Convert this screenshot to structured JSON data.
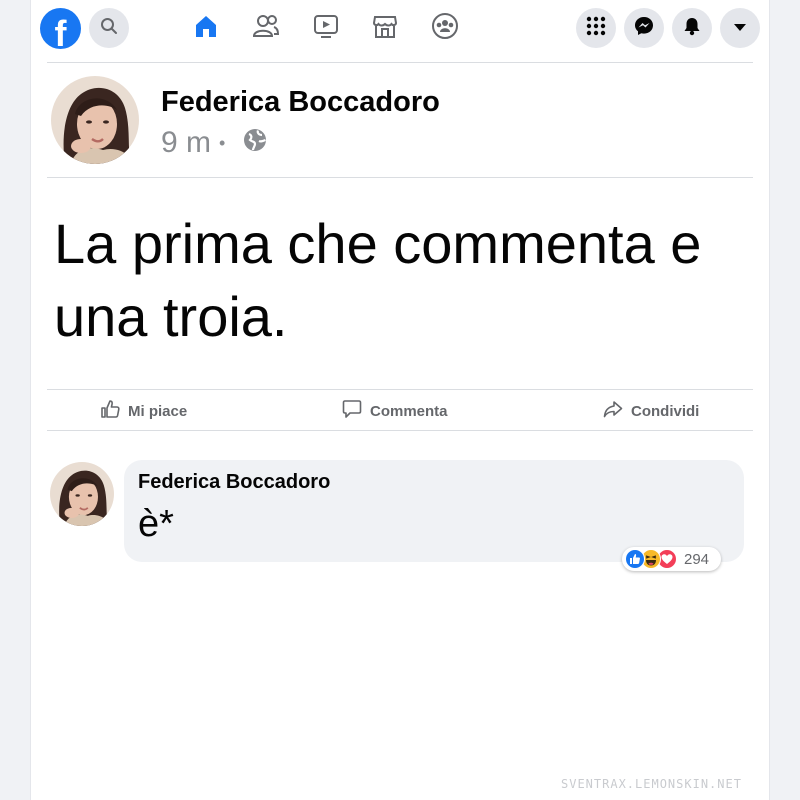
{
  "nav": {
    "logo_glyph": "f",
    "icons": [
      "search-icon",
      "home-icon",
      "friends-icon",
      "watch-icon",
      "marketplace-icon",
      "groups-icon",
      "menu-grid-icon",
      "messenger-icon",
      "notifications-icon",
      "account-dropdown-icon"
    ],
    "accent_color": "#1877f2"
  },
  "post": {
    "author": "Federica Boccadoro",
    "time": "9 m",
    "separator": "•",
    "privacy_icon": "globe-icon",
    "text": "La prima che commenta e una troia."
  },
  "actions": {
    "like": "Mi piace",
    "comment": "Commenta",
    "share": "Condividi"
  },
  "comment": {
    "author": "Federica Boccadoro",
    "text": "è*",
    "reactions": [
      "like",
      "haha",
      "love"
    ],
    "reaction_count": "294"
  },
  "watermark": "SVENTRAX.LEMONSKIN.NET"
}
